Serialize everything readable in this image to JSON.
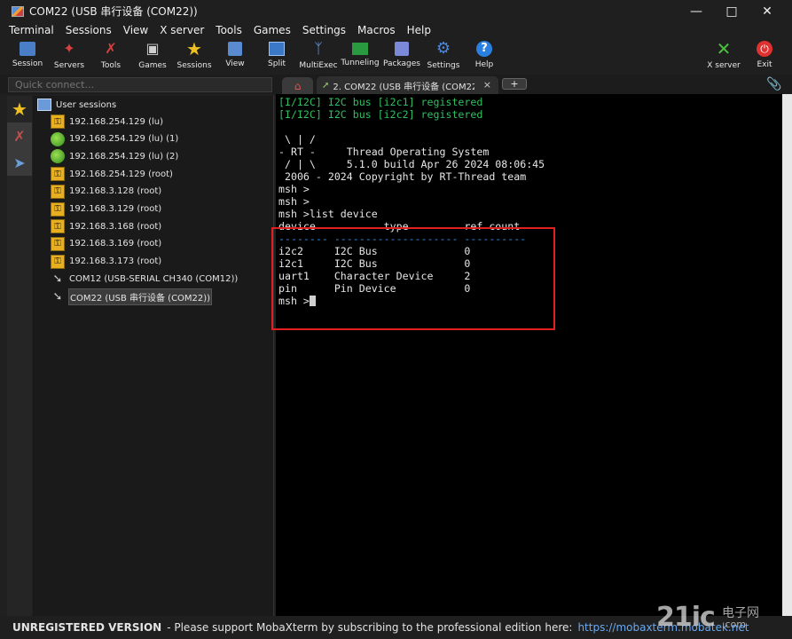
{
  "window": {
    "title": "COM22  (USB 串行设备 (COM22))",
    "controls": [
      "minimize-icon",
      "maximize-icon",
      "close-icon"
    ]
  },
  "menu": [
    "Terminal",
    "Sessions",
    "View",
    "X server",
    "Tools",
    "Games",
    "Settings",
    "Macros",
    "Help"
  ],
  "toolbar": {
    "items": [
      {
        "label": "Session",
        "icon": "session-icon"
      },
      {
        "label": "Servers",
        "icon": "servers-icon"
      },
      {
        "label": "Tools",
        "icon": "tools-icon"
      },
      {
        "label": "Games",
        "icon": "games-icon"
      },
      {
        "label": "Sessions",
        "icon": "sessions-star-icon"
      },
      {
        "label": "View",
        "icon": "view-icon"
      },
      {
        "label": "Split",
        "icon": "split-icon"
      },
      {
        "label": "MultiExec",
        "icon": "multiexec-icon"
      },
      {
        "label": "Tunneling",
        "icon": "tunneling-icon"
      },
      {
        "label": "Packages",
        "icon": "packages-icon"
      },
      {
        "label": "Settings",
        "icon": "settings-icon"
      },
      {
        "label": "Help",
        "icon": "help-icon"
      }
    ],
    "xserver_label": "X server",
    "exit_label": "Exit"
  },
  "quick_connect": {
    "placeholder": "Quick connect..."
  },
  "tabs": {
    "session_tab_label": "2. COM22  (USB 串行设备 (COM22",
    "close": "×",
    "new_tab": "+"
  },
  "sessions": {
    "root_label": "User sessions",
    "items": [
      {
        "label": "192.168.254.129 (lu)",
        "icon": "key-icon"
      },
      {
        "label": "192.168.254.129 (lu) (1)",
        "icon": "green-status-icon"
      },
      {
        "label": "192.168.254.129 (lu) (2)",
        "icon": "green-status-icon"
      },
      {
        "label": "192.168.254.129 (root)",
        "icon": "key-icon"
      },
      {
        "label": "192.168.3.128 (root)",
        "icon": "key-icon"
      },
      {
        "label": "192.168.3.129 (root)",
        "icon": "key-icon"
      },
      {
        "label": "192.168.3.168 (root)",
        "icon": "key-icon"
      },
      {
        "label": "192.168.3.169 (root)",
        "icon": "key-icon"
      },
      {
        "label": "192.168.3.173 (root)",
        "icon": "key-icon"
      },
      {
        "label": "COM12  (USB-SERIAL CH340 (COM12))",
        "icon": "serial-icon"
      },
      {
        "label": "COM22  (USB 串行设备 (COM22))",
        "icon": "serial-icon",
        "selected": true
      }
    ]
  },
  "terminal": {
    "lines": [
      {
        "text": "[I/I2C] I2C bus [i2c1] registered",
        "color": "green"
      },
      {
        "text": "[I/I2C] I2C bus [i2c2] registered",
        "color": "green"
      },
      {
        "text": "",
        "color": ""
      },
      {
        "text": " \\ | /",
        "color": ""
      },
      {
        "text": "- RT -     Thread Operating System",
        "color": ""
      },
      {
        "text": " / | \\     5.1.0 build Apr 26 2024 08:06:45",
        "color": ""
      },
      {
        "text": " 2006 - 2024 Copyright by RT-Thread team",
        "color": ""
      },
      {
        "text": "msh >",
        "color": ""
      },
      {
        "text": "msh >",
        "color": ""
      },
      {
        "text": "msh >list device",
        "color": ""
      },
      {
        "text": "device           type         ref count",
        "color": ""
      },
      {
        "text": "-------- -------------------- ----------",
        "color": "blue"
      },
      {
        "text": "i2c2     I2C Bus              0",
        "color": ""
      },
      {
        "text": "i2c1     I2C Bus              0",
        "color": ""
      },
      {
        "text": "uart1    Character Device     2",
        "color": ""
      },
      {
        "text": "pin      Pin Device           0",
        "color": ""
      }
    ],
    "prompt": "msh >"
  },
  "statusbar": {
    "unregistered": "UNREGISTERED VERSION",
    "message": " -  Please support MobaXterm by subscribing to the professional edition here:",
    "url": "https://mobaxterm.mobatek.net"
  },
  "watermark": {
    "logo": "21ic",
    "cn": "电子网",
    "url": ".com"
  }
}
